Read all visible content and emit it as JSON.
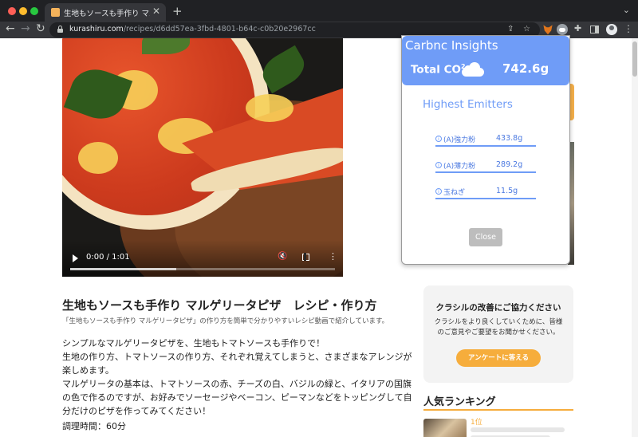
{
  "browser": {
    "tab_title": "生地もソースも手作り マルゲリータ",
    "url_host": "kurashiru.com",
    "url_path": "/recipes/d6dd57ea-3fbd-4801-b64c-c0b20e2967cc",
    "icons": [
      "back-icon",
      "forward-icon",
      "reload-icon",
      "lock-icon",
      "share-icon",
      "star-icon",
      "metamask-icon",
      "carbon-extension-icon",
      "puzzle-icon",
      "sidepanel-icon",
      "profile-icon",
      "menu-icon"
    ]
  },
  "video": {
    "time": "0:00 / 1:01",
    "progress_buffered": 0.4
  },
  "recipe": {
    "title": "生地もソースも手作り マルゲリータピザ　レシピ・作り方",
    "subtitle": "「生地もソースも手作り マルゲリータピザ」の作り方を簡単で分かりやすいレシピ動画で紹介しています。",
    "body": [
      "シンプルなマルゲリータピザを、生地もトマトソースも手作りで！",
      "生地の作り方、トマトソースの作り方、それぞれ覚えてしまうと、さまざまなアレンジが",
      "楽しめます。",
      "マルゲリータの基本は、トマトソースの赤、チーズの白、バジルの緑と、イタリアの国旗",
      "の色で作るのですが、お好みでソーセージやベーコン、ピーマンなどをトッピングして自",
      "分だけのピザを作ってみてください！"
    ],
    "cook_time": "調理時間：60分"
  },
  "survey": {
    "title": "クラシルの改善にご協力ください",
    "text_line1": "クラシルをより良くしていくために、皆様",
    "text_line2": "のご意見やご要望をお聞かせください。",
    "button": "アンケートに答える"
  },
  "ranking": {
    "title": "人気ランキング",
    "first_rank": "1位"
  },
  "popup": {
    "title": "Carbnc Insights",
    "total_label": "Total CO",
    "total_sup": "2",
    "total_value": "742.6g",
    "emitters_title": "Highest Emitters",
    "emitters": [
      {
        "name": "(A)強力粉",
        "value": "433.8g"
      },
      {
        "name": "(A)薄力粉",
        "value": "289.2g"
      },
      {
        "name": "玉ねぎ",
        "value": "11.5g"
      }
    ],
    "close_label": "Close"
  },
  "colors": {
    "popup_accent": "#6f9cf7",
    "survey_button": "#f6ad3c",
    "chrome_dark": "#202124"
  }
}
